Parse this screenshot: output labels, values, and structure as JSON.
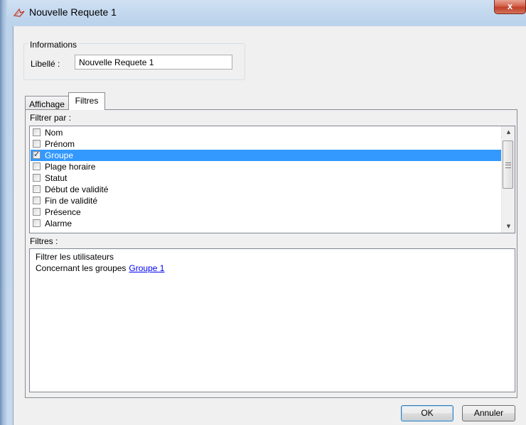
{
  "window": {
    "title": "Nouvelle Requete 1",
    "close_label": "x"
  },
  "info": {
    "legend": "Informations",
    "libelle_label": "Libellé :",
    "libelle_value": "Nouvelle Requete 1"
  },
  "tabs": [
    {
      "label": "Affichage",
      "active": false
    },
    {
      "label": "Filtres",
      "active": true
    }
  ],
  "filter_by": {
    "label": "Filtrer par :",
    "items": [
      {
        "label": "Nom",
        "checked": false,
        "selected": false
      },
      {
        "label": "Prénom",
        "checked": false,
        "selected": false
      },
      {
        "label": "Groupe",
        "checked": true,
        "selected": true
      },
      {
        "label": "Plage horaire",
        "checked": false,
        "selected": false
      },
      {
        "label": "Statut",
        "checked": false,
        "selected": false
      },
      {
        "label": "Début de validité",
        "checked": false,
        "selected": false
      },
      {
        "label": "Fin de validité",
        "checked": false,
        "selected": false
      },
      {
        "label": "Présence",
        "checked": false,
        "selected": false
      },
      {
        "label": "Alarme",
        "checked": false,
        "selected": false
      }
    ]
  },
  "filters": {
    "label": "Filtres :",
    "line1": "Filtrer les utilisateurs",
    "line2_prefix": "Concernant les groupes",
    "group_link": "Groupe 1"
  },
  "buttons": {
    "ok": "OK",
    "cancel": "Annuler"
  },
  "colors": {
    "selection": "#3399ff",
    "link": "#0000ee"
  }
}
